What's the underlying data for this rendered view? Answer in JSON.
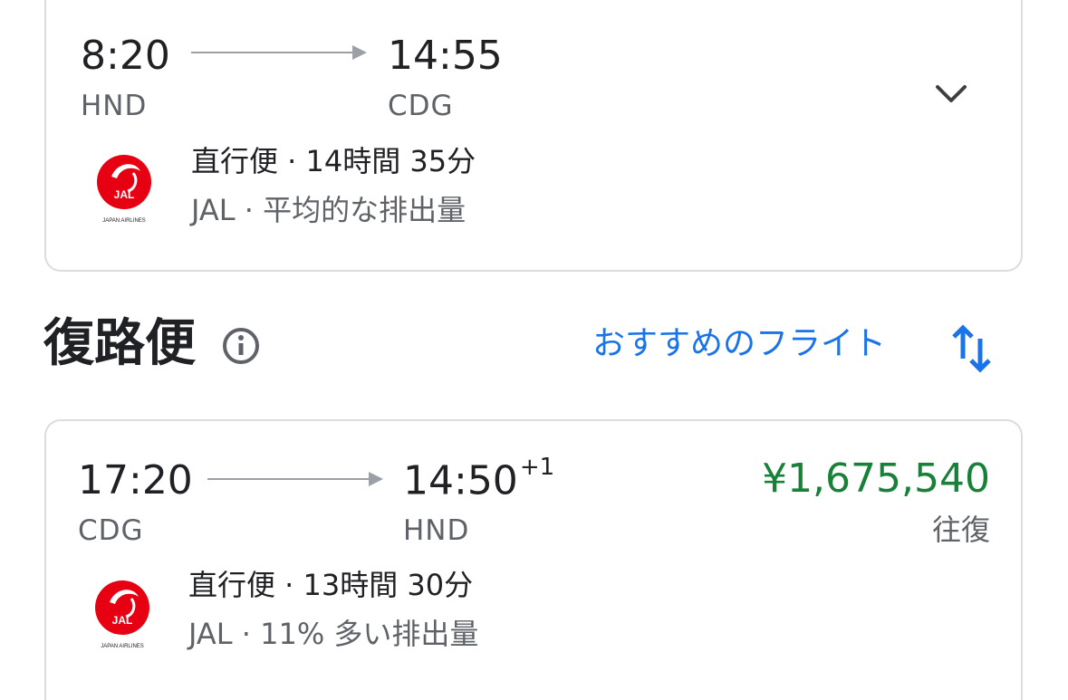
{
  "outbound": {
    "depart_time": "8:20",
    "arrive_time": "14:55",
    "depart_airport": "HND",
    "arrive_airport": "CDG",
    "detail_line1": "直行便 · 14時間 35分",
    "detail_line2": "JAL · 平均的な排出量",
    "airline_logo_text": "JAL",
    "airline_logo_subtext": "JAPAN AIRLINES",
    "expand_icon": "chevron-down-icon"
  },
  "return_section": {
    "title": "復路便",
    "info_icon": "info-icon",
    "sort_label": "おすすめのフライト",
    "sort_icon": "sort-arrows-icon"
  },
  "return_flight": {
    "depart_time": "17:20",
    "arrive_time": "14:50",
    "arrive_day_offset": "+1",
    "depart_airport": "CDG",
    "arrive_airport": "HND",
    "price": "¥1,675,540",
    "trip_type": "往復",
    "detail_line1": "直行便 · 13時間 30分",
    "detail_line2": "JAL · 11% 多い排出量",
    "airline_logo_text": "JAL",
    "airline_logo_subtext": "JAPAN AIRLINES"
  },
  "colors": {
    "accent": "#1a73e8",
    "price": "#188038",
    "jal_red": "#e60012",
    "border": "#dadce0"
  }
}
